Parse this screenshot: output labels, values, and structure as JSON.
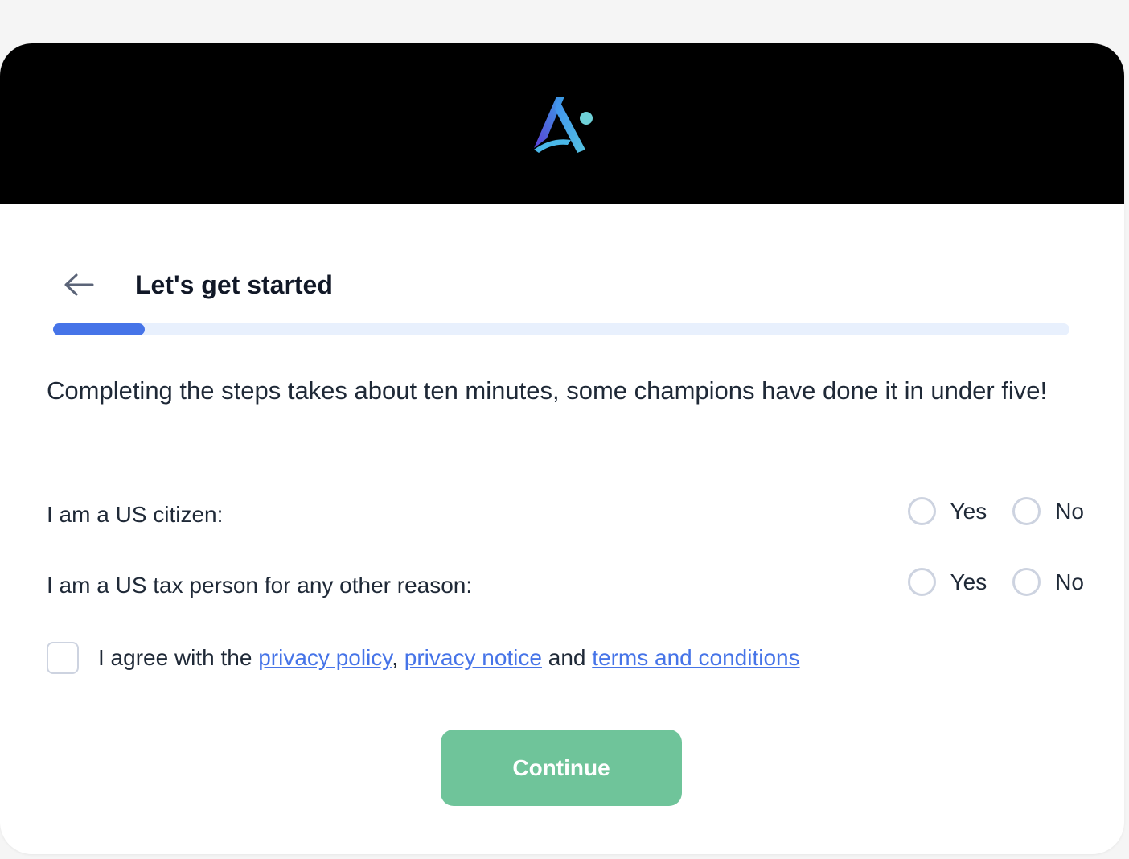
{
  "header": {
    "logo_name": "app-logo"
  },
  "titlebar": {
    "back_icon": "arrow-left-icon",
    "title": "Let's get started"
  },
  "progress": {
    "fraction": 0.09
  },
  "intro": "Completing the steps takes about ten minutes, some champions have done it in under five!",
  "questions": [
    {
      "label": "I am a US citizen:",
      "options": [
        "Yes",
        "No"
      ]
    },
    {
      "label": "I am a US tax person for any other reason:",
      "options": [
        "Yes",
        "No"
      ]
    }
  ],
  "agreement": {
    "prefix": "I agree with the ",
    "link1": "privacy policy",
    "sep1": ", ",
    "link2": "privacy notice",
    "sep2": " and ",
    "link3": "terms and conditions"
  },
  "actions": {
    "continue_label": "Continue"
  },
  "colors": {
    "accent": "#4674e8",
    "button": "#6fc49a",
    "header_bg": "#000000"
  }
}
